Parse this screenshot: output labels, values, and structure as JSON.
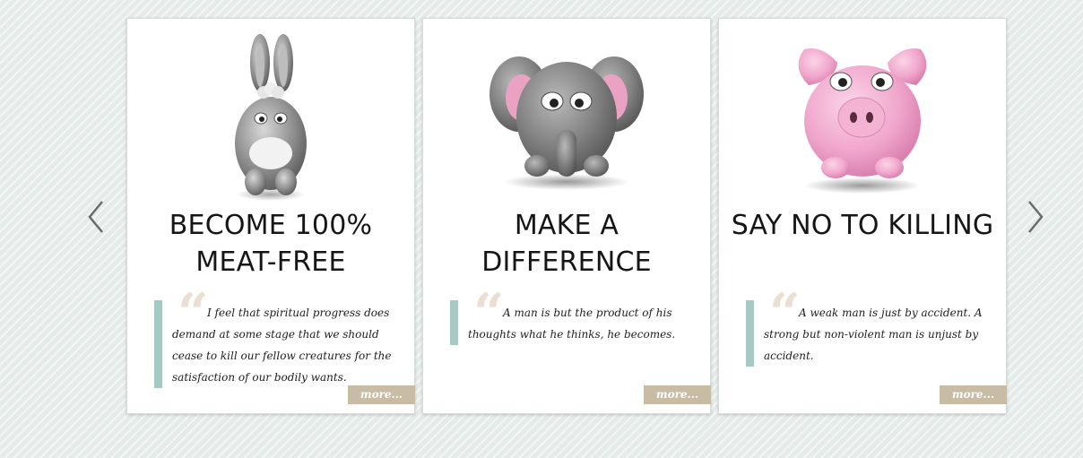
{
  "carousel": {
    "prev_icon": "chevron-left-icon",
    "next_icon": "chevron-right-icon",
    "arrow_color": "#6b6b6b",
    "cards": [
      {
        "title": "BECOME 100% MEAT-FREE",
        "image": "donkey-icon",
        "quote": "I feel that spiritual progress does demand at some stage that we should cease to kill our fellow creatures for the satisfaction of our bodily wants.",
        "more_label": "more..."
      },
      {
        "title": "MAKE A DIFFERENCE",
        "image": "elephant-icon",
        "quote": "A man is but the product of his thoughts what he thinks, he becomes.",
        "more_label": "more..."
      },
      {
        "title": "SAY NO TO KILLING",
        "image": "pig-icon",
        "quote": "A weak man is just by accident. A strong but non-violent man is unjust by accident.",
        "more_label": "more..."
      }
    ],
    "colors": {
      "quote_bar": "#a7c9c3",
      "more_button": "#c9bca4",
      "quote_mark": "#eadfd0"
    }
  }
}
